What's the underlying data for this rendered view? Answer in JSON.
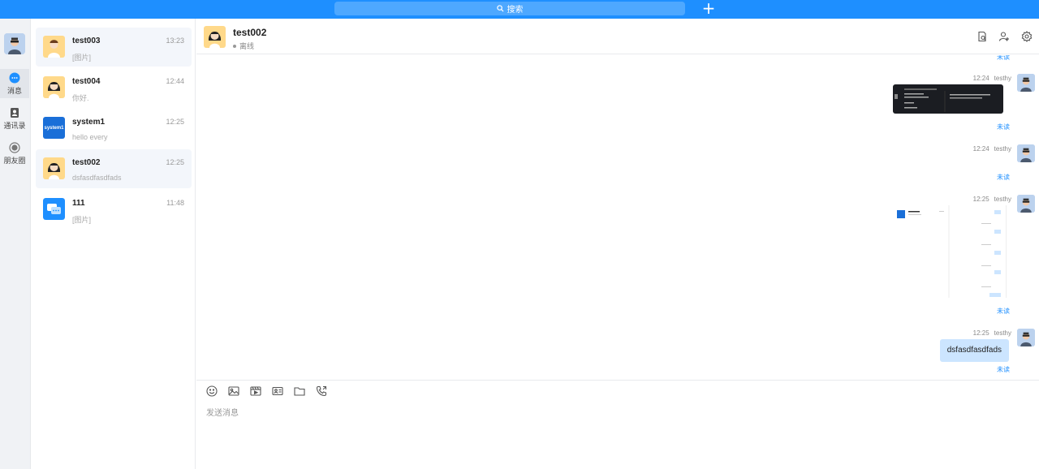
{
  "topbar": {
    "search_label": "搜索",
    "add_label": "+"
  },
  "rail": {
    "items": [
      {
        "label": "消息",
        "icon": "chat-bubble-icon"
      },
      {
        "label": "通讯录",
        "icon": "contacts-icon"
      },
      {
        "label": "朋友圈",
        "icon": "moments-icon"
      }
    ]
  },
  "conversations": [
    {
      "name": "test003",
      "time": "13:23",
      "preview": "[图片]",
      "avatar": "boy"
    },
    {
      "name": "test004",
      "time": "12:44",
      "preview": "你好.",
      "avatar": "girl"
    },
    {
      "name": "system1",
      "time": "12:25",
      "preview": "hello every",
      "avatar": "system",
      "avatar_text": "system1"
    },
    {
      "name": "test002",
      "time": "12:25",
      "preview": "dsfasdfasdfads",
      "avatar": "girl"
    },
    {
      "name": "111",
      "time": "11:48",
      "preview": "[图片]",
      "avatar": "group"
    }
  ],
  "chat": {
    "title": "test002",
    "status": "离线",
    "messages": [
      {
        "time": "12:24",
        "sender": "testhy",
        "type": "image",
        "read_status": "未读"
      },
      {
        "time": "12:24",
        "sender": "testhy",
        "type": "empty",
        "read_status": "未读"
      },
      {
        "time": "12:25",
        "sender": "testhy",
        "type": "image",
        "read_status": "未读"
      },
      {
        "time": "12:25",
        "sender": "testhy",
        "type": "text",
        "text": "dsfasdfasdfads",
        "read_status": "未读"
      }
    ],
    "top_read_status": "未读"
  },
  "composer": {
    "placeholder": "发送消息",
    "tools": [
      "emoji-icon",
      "image-icon",
      "video-icon",
      "card-icon",
      "folder-icon",
      "phone-icon"
    ]
  },
  "colors": {
    "accent": "#1e8fff",
    "bubble": "#cce5ff",
    "rail_bg": "#f0f2f5"
  }
}
